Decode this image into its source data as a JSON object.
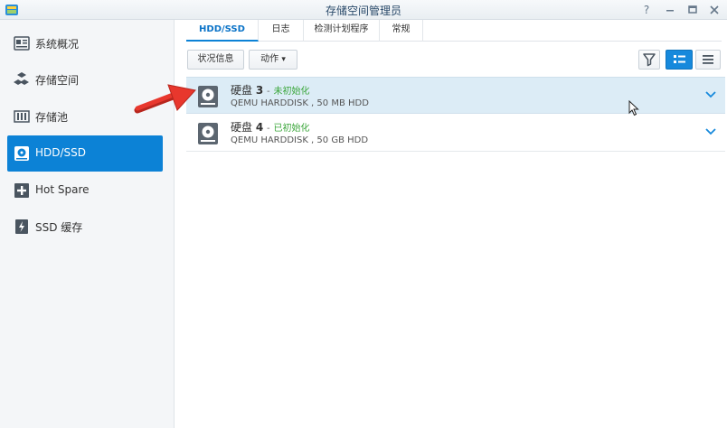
{
  "window": {
    "title": "存储空间管理员",
    "help_label": "?"
  },
  "sidebar": {
    "items": [
      {
        "label": "系统概况",
        "icon": "overview-icon"
      },
      {
        "label": "存储空间",
        "icon": "volume-icon"
      },
      {
        "label": "存储池",
        "icon": "storage-pool-icon"
      },
      {
        "label": "HDD/SSD",
        "icon": "disk-icon",
        "active": true
      },
      {
        "label": "Hot Spare",
        "icon": "hot-spare-icon"
      },
      {
        "label": "SSD 缓存",
        "icon": "ssd-cache-icon"
      }
    ]
  },
  "tabs": [
    {
      "label": "HDD/SSD",
      "active": true
    },
    {
      "label": "日志"
    },
    {
      "label": "检测计划程序"
    },
    {
      "label": "常规"
    }
  ],
  "toolbar": {
    "status_label": "状况信息",
    "action_label": "动作",
    "action_caret": "▾"
  },
  "disks": [
    {
      "name": "硬盘",
      "number": "3",
      "separator": "-",
      "status": "未初始化",
      "model": "QEMU HARDDISK , 50 MB HDD",
      "highlighted": true
    },
    {
      "name": "硬盘",
      "number": "4",
      "separator": "-",
      "status": "已初始化",
      "model": "QEMU HARDDISK , 50 GB HDD",
      "highlighted": false
    }
  ],
  "colors": {
    "accent": "#0c82d6",
    "status_green": "#3aa63a",
    "row_highlight": "#dcecf6",
    "arrow_red": "#e8372d"
  }
}
